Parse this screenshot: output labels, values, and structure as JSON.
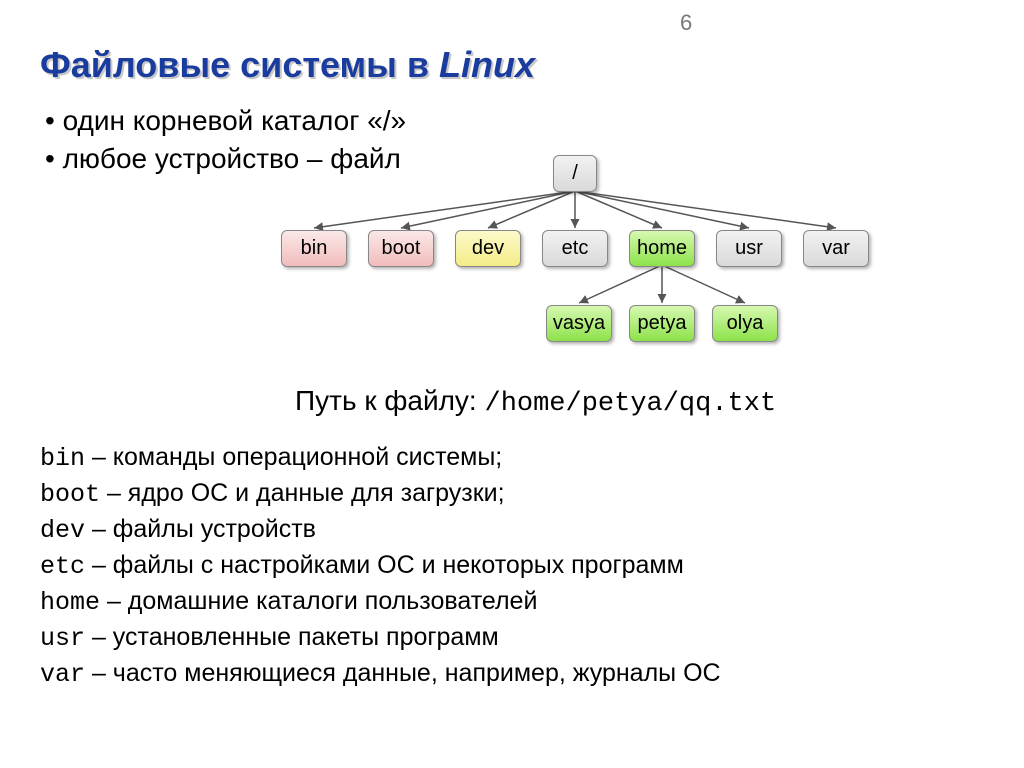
{
  "page_number": "6",
  "title_main": "Файловые системы в",
  "title_linux": "Linux",
  "bullets": {
    "b1": "один корневой каталог «/»",
    "b2": "любое устройство – файл"
  },
  "tree": {
    "root": "/",
    "l1": {
      "bin": "bin",
      "boot": "boot",
      "dev": "dev",
      "etc": "etc",
      "home": "home",
      "usr": "usr",
      "var": "var"
    },
    "l2": {
      "vasya": "vasya",
      "petya": "petya",
      "olya": "olya"
    }
  },
  "path_label": "Путь к файлу:",
  "path_value": "/home/petya/qq.txt",
  "desc": {
    "bin": {
      "k": "bin",
      "t": " – команды операционной системы;"
    },
    "boot": {
      "k": "boot",
      "t": " – ядро ОС и данные для загрузки;"
    },
    "dev": {
      "k": "dev",
      "t": " – файлы устройств"
    },
    "etc": {
      "k": "etc",
      "t": " – файлы с настройками ОС и некоторых программ"
    },
    "home": {
      "k": "home",
      "t": " – домашние каталоги пользователей"
    },
    "usr": {
      "k": "usr",
      "t": " – установленные пакеты программ"
    },
    "var": {
      "k": "var",
      "t": " – часто меняющиеся данные,  например, журналы ОС"
    }
  }
}
